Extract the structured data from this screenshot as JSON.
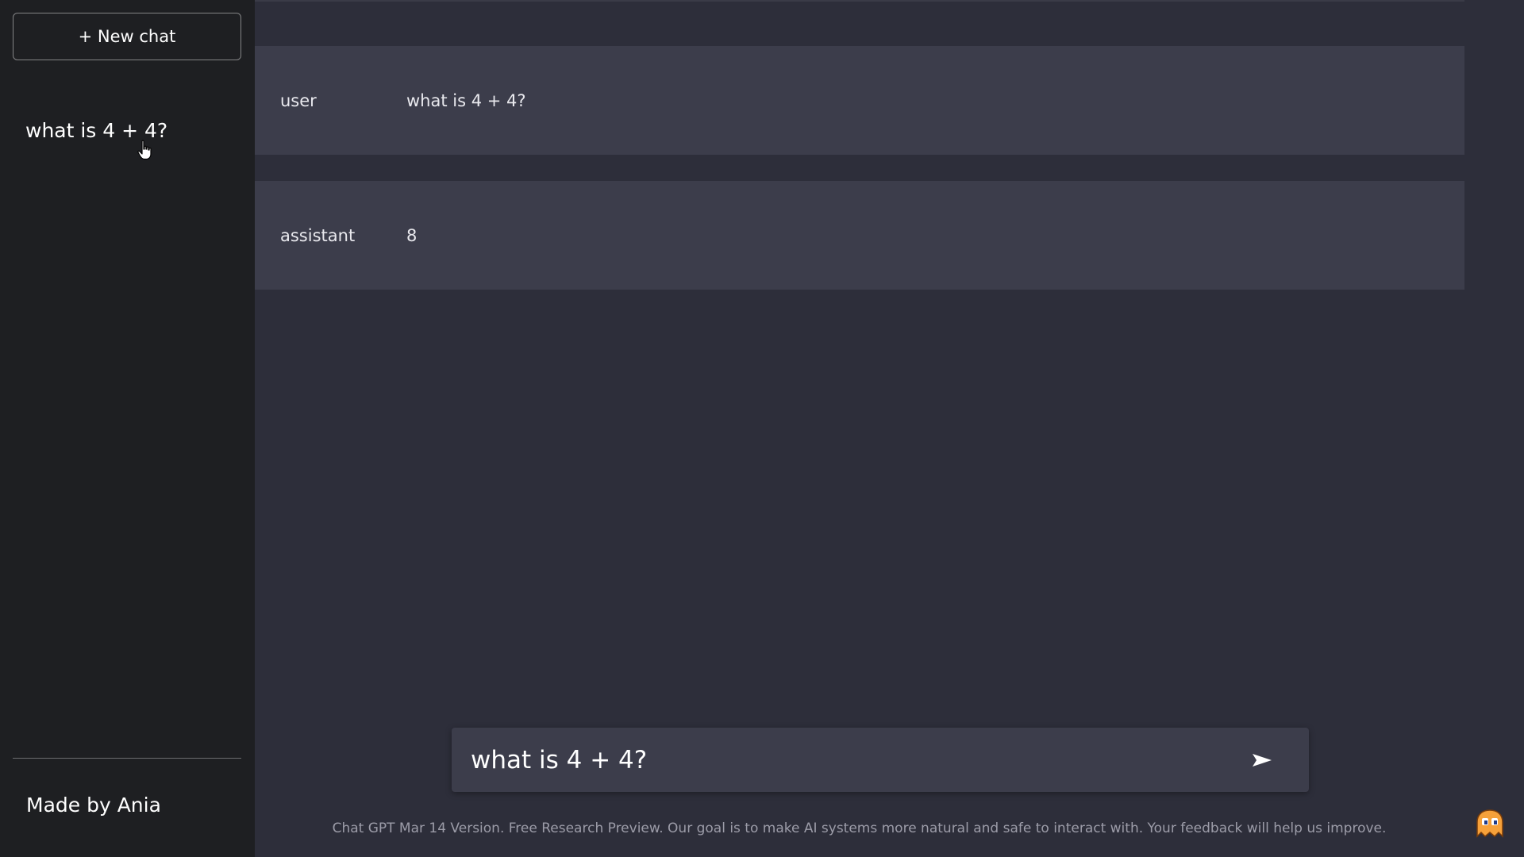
{
  "sidebar": {
    "new_chat_label": "+ New chat",
    "history": [
      {
        "title": "what is 4 + 4?"
      }
    ],
    "footer_text": "Made by Ania"
  },
  "conversation": {
    "messages": [
      {
        "role": "user",
        "content": "what is 4 + 4?"
      },
      {
        "role": "assistant",
        "content": "8"
      }
    ]
  },
  "input": {
    "value": "what is 4 + 4?",
    "send_icon": "send-arrow-icon"
  },
  "footer": {
    "disclaimer": "Chat GPT Mar 14 Version. Free Research Preview. Our goal is to make AI systems more natural and safe to interact with. Your feedback will help us improve."
  },
  "colors": {
    "sidebar_bg": "#1e1f22",
    "main_bg": "#2d2e3a",
    "message_bg": "#3c3d4b",
    "footer_text": "#9c9ca8"
  }
}
